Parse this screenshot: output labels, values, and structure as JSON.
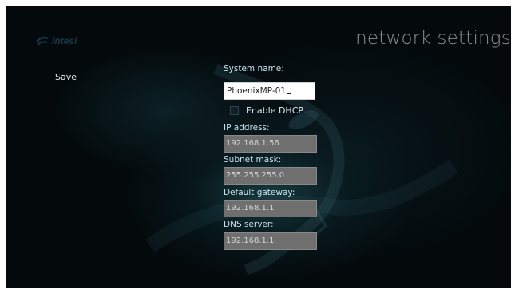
{
  "brand": {
    "logo_text": "intesi",
    "logo_icon": "intesis-swirl-icon"
  },
  "header": {
    "title": "network settings"
  },
  "actions": {
    "save_label": "Save"
  },
  "form": {
    "system_name": {
      "label": "System name:",
      "value": "PhoenixMP-01"
    },
    "dhcp": {
      "label": "Enable DHCP",
      "checked": false
    },
    "ip_address": {
      "label": "IP address:",
      "value": "192.168.1.56"
    },
    "subnet_mask": {
      "label": "Subnet mask:",
      "value": "255.255.255.0"
    },
    "default_gateway": {
      "label": "Default gateway:",
      "value": "192.168.1.1"
    },
    "dns_server": {
      "label": "DNS server:",
      "value": "192.168.1.1"
    }
  },
  "colors": {
    "background": "#040a0c",
    "label": "#c8e2ee",
    "title": "#8a8f92",
    "disabled_field": "#6f6f6f",
    "active_field": "#ffffff"
  }
}
